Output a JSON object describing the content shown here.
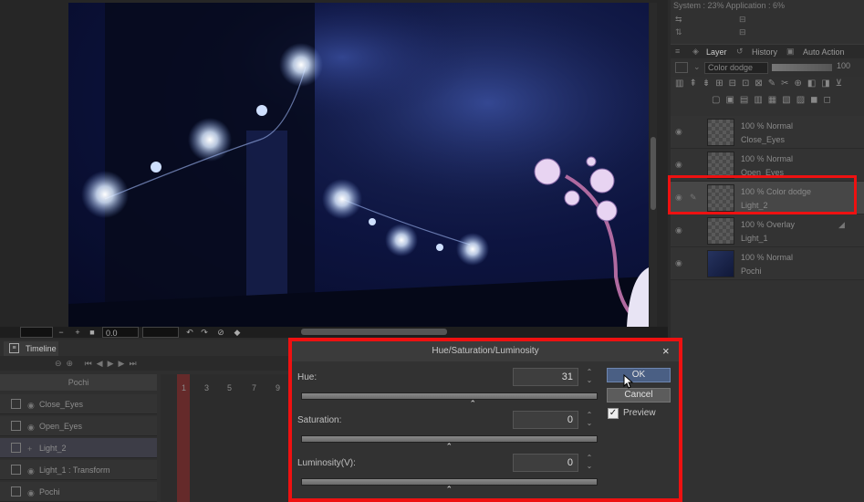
{
  "canvas": {
    "zoom_value": "0.0"
  },
  "system_info": {
    "text": "System : 23%  Application : 6%"
  },
  "layer_panel": {
    "tabs": [
      {
        "label": "Layer",
        "icon": "layer-icon"
      },
      {
        "label": "History",
        "icon": "history-icon"
      },
      {
        "label": "Auto Action",
        "icon": "auto-action-icon"
      }
    ],
    "blend_mode": "Color dodge",
    "opacity_value": "100",
    "layers": [
      {
        "mode": "100 % Normal",
        "name": "Close_Eyes",
        "selected": false
      },
      {
        "mode": "100 % Normal",
        "name": "Open_Eyes",
        "selected": false
      },
      {
        "mode": "100 % Color dodge",
        "name": "Light_2",
        "selected": true
      },
      {
        "mode": "100 % Overlay",
        "name": "Light_1",
        "selected": false
      },
      {
        "mode": "100 % Normal",
        "name": "Pochi",
        "selected": false
      }
    ]
  },
  "timeline": {
    "tab_label": "Timeline",
    "header": "Pochi",
    "tracks": [
      {
        "label": "Close_Eyes",
        "selected": false
      },
      {
        "label": "Open_Eyes",
        "selected": false
      },
      {
        "label": "Light_2",
        "selected": true
      },
      {
        "label": "Light_1 : Transform",
        "selected": false
      },
      {
        "label": "Pochi",
        "selected": false
      }
    ],
    "frame_numbers": [
      "1",
      "3",
      "5",
      "7",
      "9"
    ]
  },
  "dialog": {
    "title": "Hue/Saturation/Luminosity",
    "close_symbol": "×",
    "hue": {
      "label": "Hue:",
      "value": "31",
      "slider_fraction": 0.58
    },
    "saturation": {
      "label": "Saturation:",
      "value": "0",
      "slider_fraction": 0.5
    },
    "luminosity": {
      "label": "Luminosity(V):",
      "value": "0",
      "slider_fraction": 0.5
    },
    "ok_label": "OK",
    "cancel_label": "Cancel",
    "preview_label": "Preview",
    "preview_checked": true
  },
  "colors": {
    "highlight": "#e11111",
    "ok_button": "#4a5f84",
    "night_sky": "#0d1440"
  }
}
